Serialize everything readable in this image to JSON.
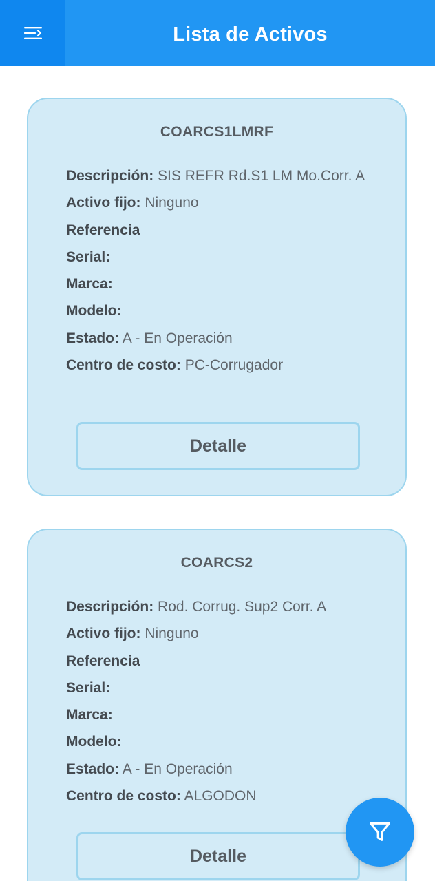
{
  "header": {
    "title": "Lista de Activos",
    "menu_icon": "menu-icon",
    "bar_color": "#2196f3",
    "menu_button_color": "#0f87ef"
  },
  "labels": {
    "descripcion": "Descripción:",
    "activo_fijo": "Activo fijo:",
    "referencia": "Referencia",
    "serial": "Serial:",
    "marca": "Marca:",
    "modelo": "Modelo:",
    "estado": "Estado:",
    "centro_costo": "Centro de costo:"
  },
  "assets": [
    {
      "code": "COARCS1LMRF",
      "descripcion": "SIS REFR Rd.S1 LM Mo.Corr. A",
      "activo_fijo": "Ninguno",
      "referencia": "",
      "serial": "",
      "marca": "",
      "modelo": "",
      "estado": "A - En Operación",
      "centro_costo": "PC-Corrugador",
      "detail_label": "Detalle"
    },
    {
      "code": "COARCS2",
      "descripcion": "Rod. Corrug. Sup2 Corr. A",
      "activo_fijo": "Ninguno",
      "referencia": "",
      "serial": "",
      "marca": "",
      "modelo": "",
      "estado": "A - En Operación",
      "centro_costo": "ALGODON",
      "detail_label": "Detalle"
    }
  ],
  "fab": {
    "icon": "filter-icon",
    "color": "#2196f3"
  },
  "colors": {
    "card_bg": "#d3ebf7",
    "card_border": "#9dd5ee"
  }
}
